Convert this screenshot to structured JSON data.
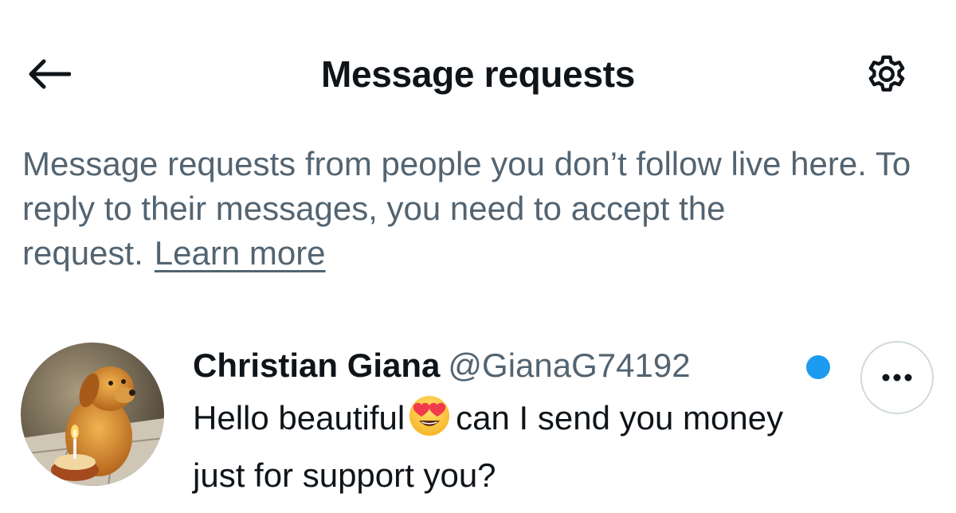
{
  "header": {
    "title": "Message requests",
    "back_icon": "arrow-left-icon",
    "settings_icon": "gear-icon"
  },
  "info": {
    "text": "Message requests from people you don’t follow live here. To reply to their messages, you need to accept the request.",
    "learn_more": "Learn more"
  },
  "request": {
    "name": "Christian Giana",
    "handle": "@GianaG74192",
    "message_before_emoji": "Hello beautiful",
    "emoji": "heart-eyes-emoji",
    "message_after_emoji": "can I send you money just for support you?",
    "unread": true,
    "more_icon": "more-horizontal-icon"
  },
  "colors": {
    "text_primary": "#0f1419",
    "text_secondary": "#536471",
    "accent_blue": "#1d9bf0",
    "border": "#cfd9de"
  }
}
